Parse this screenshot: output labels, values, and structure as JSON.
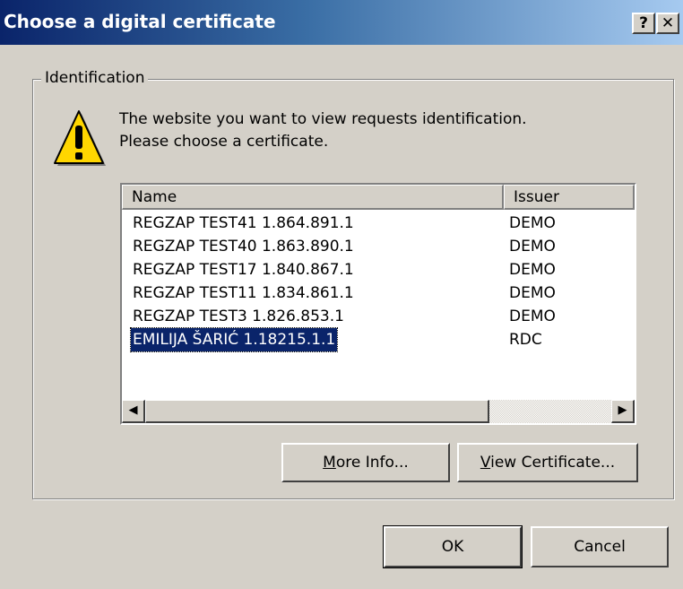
{
  "window": {
    "title": "Choose a digital certificate",
    "help_label": "?",
    "close_label": "✕"
  },
  "group": {
    "legend": "Identification"
  },
  "message": {
    "line1": "The website you want to view requests identification.",
    "line2": "Please choose a certificate."
  },
  "certificates": {
    "columns": [
      "Name",
      "Issuer"
    ],
    "rows": [
      {
        "name": "REGZAP TEST41 1.864.891.1",
        "issuer": "DEMO",
        "selected": false
      },
      {
        "name": "REGZAP TEST40 1.863.890.1",
        "issuer": "DEMO",
        "selected": false
      },
      {
        "name": "REGZAP TEST17 1.840.867.1",
        "issuer": "DEMO",
        "selected": false
      },
      {
        "name": "REGZAP TEST11 1.834.861.1",
        "issuer": "DEMO",
        "selected": false
      },
      {
        "name": "REGZAP TEST3 1.826.853.1",
        "issuer": "DEMO",
        "selected": false
      },
      {
        "name": "EMILIJA ŠARIĆ 1.18215.1.1",
        "issuer": "RDC",
        "selected": true
      }
    ]
  },
  "buttons": {
    "more_info_mnemonic": "M",
    "more_info_rest": "ore Info...",
    "view_cert_mnemonic": "V",
    "view_cert_rest": "iew Certificate...",
    "ok": "OK",
    "cancel": "Cancel"
  },
  "icons": {
    "warning": "warning-icon",
    "scroll_left": "◀",
    "scroll_right": "▶"
  }
}
